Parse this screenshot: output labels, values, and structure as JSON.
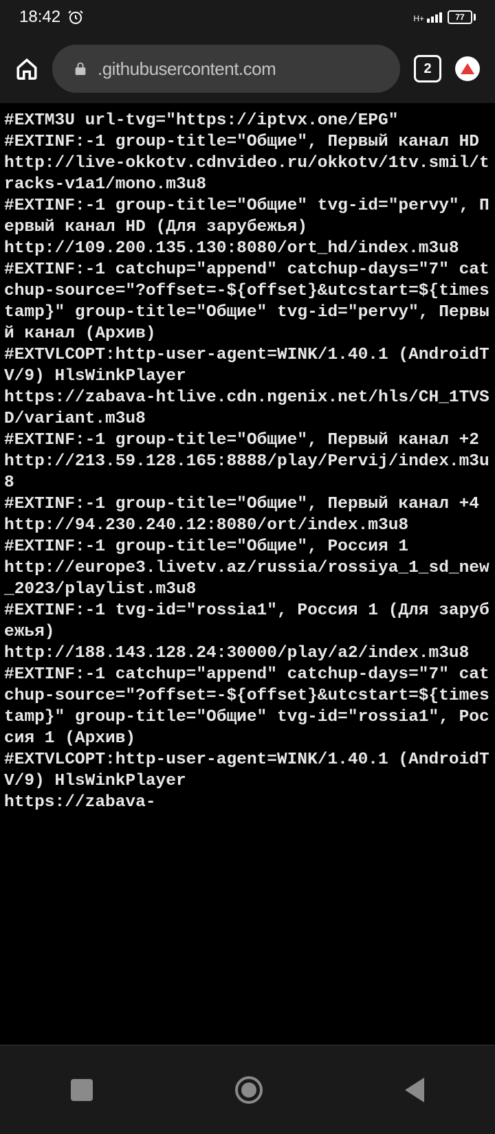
{
  "status": {
    "time": "18:42",
    "network": "H+",
    "battery": "77"
  },
  "browser": {
    "url": ".githubusercontent.com",
    "tabs": "2"
  },
  "body": "#EXTM3U url-tvg=\"https://iptvx.one/EPG\"\n#EXTINF:-1 group-title=\"Общие\", Первый канал HD\nhttp://live-okkotv.cdnvideo.ru/okkotv/1tv.smil/tracks-v1a1/mono.m3u8\n#EXTINF:-1 group-title=\"Общие\" tvg-id=\"pervy\", Первый канал HD (Для зарубежья)\nhttp://109.200.135.130:8080/ort_hd/index.m3u8\n#EXTINF:-1 catchup=\"append\" catchup-days=\"7\" catchup-source=\"?offset=-${offset}&utcstart=${timestamp}\" group-title=\"Общие\" tvg-id=\"pervy\", Первый канал (Архив)\n#EXTVLCOPT:http-user-agent=WINK/1.40.1 (AndroidTV/9) HlsWinkPlayer\nhttps://zabava-htlive.cdn.ngenix.net/hls/CH_1TVSD/variant.m3u8\n#EXTINF:-1 group-title=\"Общие\", Первый канал +2\nhttp://213.59.128.165:8888/play/Pervij/index.m3u8\n#EXTINF:-1 group-title=\"Общие\", Первый канал +4\nhttp://94.230.240.12:8080/ort/index.m3u8\n#EXTINF:-1 group-title=\"Общие\", Россия 1\nhttp://europe3.livetv.az/russia/rossiya_1_sd_new_2023/playlist.m3u8\n#EXTINF:-1 tvg-id=\"rossia1\", Россия 1 (Для зарубежья)\nhttp://188.143.128.24:30000/play/a2/index.m3u8\n#EXTINF:-1 catchup=\"append\" catchup-days=\"7\" catchup-source=\"?offset=-${offset}&utcstart=${timestamp}\" group-title=\"Общие\" tvg-id=\"rossia1\", Россия 1 (Архив)\n#EXTVLCOPT:http-user-agent=WINK/1.40.1 (AndroidTV/9) HlsWinkPlayer\nhttps://zabava-"
}
